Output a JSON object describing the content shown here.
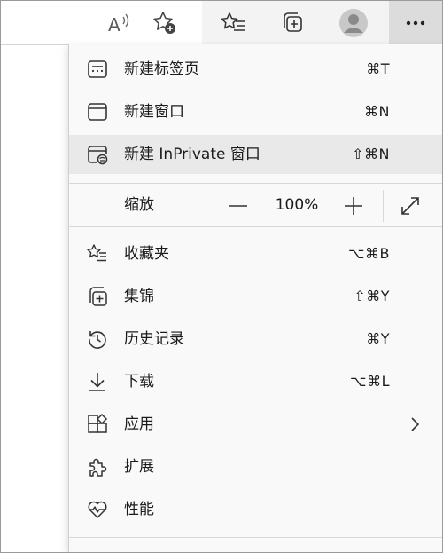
{
  "toolbar": {
    "icons": [
      "read-aloud-icon",
      "add-favorite-icon",
      "favorites-icon",
      "collections-icon",
      "profile-icon",
      "more-icon"
    ]
  },
  "menu": {
    "items": [
      {
        "label": "新建标签页",
        "shortcut": "⌘T",
        "icon": "new-tab-icon"
      },
      {
        "label": "新建窗口",
        "shortcut": "⌘N",
        "icon": "new-window-icon"
      },
      {
        "label": "新建 InPrivate 窗口",
        "shortcut": "⇧⌘N",
        "icon": "inprivate-window-icon"
      }
    ],
    "zoom": {
      "label": "缩放",
      "value": "100%"
    },
    "items2": [
      {
        "label": "收藏夹",
        "shortcut": "⌥⌘B",
        "icon": "favorites-icon"
      },
      {
        "label": "集锦",
        "shortcut": "⇧⌘Y",
        "icon": "collections-icon"
      },
      {
        "label": "历史记录",
        "shortcut": "⌘Y",
        "icon": "history-icon"
      },
      {
        "label": "下载",
        "shortcut": "⌥⌘L",
        "icon": "download-icon"
      },
      {
        "label": "应用",
        "shortcut": "",
        "icon": "apps-icon"
      },
      {
        "label": "扩展",
        "shortcut": "",
        "icon": "extensions-icon"
      },
      {
        "label": "性能",
        "shortcut": "",
        "icon": "performance-icon"
      }
    ]
  },
  "colors": {
    "menu_bg": "#f9f9f9",
    "hover_bg": "#e9e9e9",
    "toolbar_bg": "#f3f3f3",
    "more_active_bg": "#dcdcdc"
  }
}
